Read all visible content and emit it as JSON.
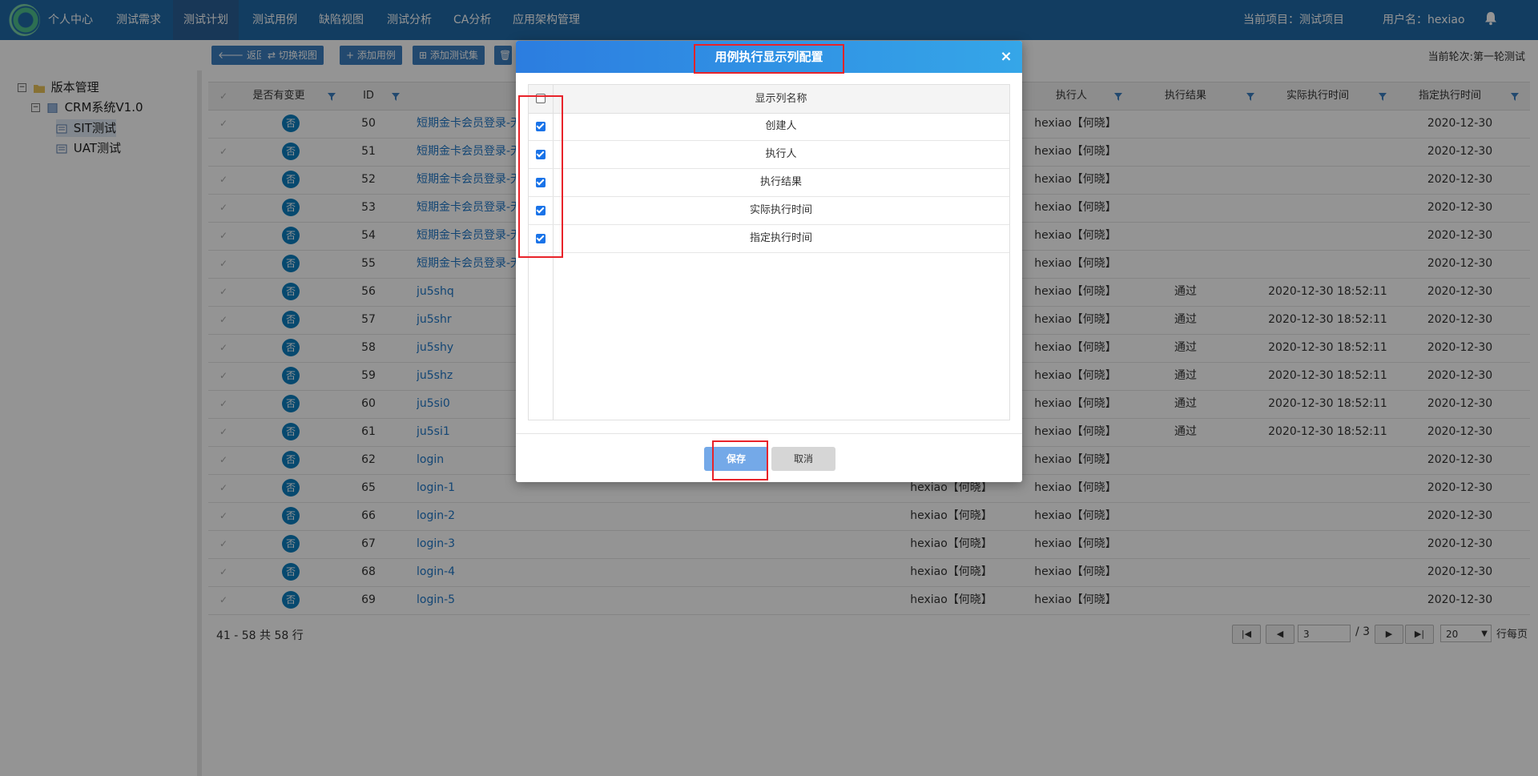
{
  "nav": {
    "items": [
      "个人中心",
      "测试需求",
      "测试计划",
      "测试用例",
      "缺陷视图",
      "测试分析",
      "CA分析",
      "应用架构管理"
    ],
    "active_index": 2,
    "current_project": "当前项目：测试项目",
    "username": "用户名：hexiao"
  },
  "toolbar": {
    "buttons": [
      "返回",
      "切换视图",
      "添加用例",
      "添加测试集"
    ],
    "current_round": "当前轮次:第一轮测试"
  },
  "tree": {
    "root": "版本管理",
    "project": "CRM系统V1.0",
    "nodes": [
      "SIT测试",
      "UAT测试"
    ],
    "selected": "SIT测试"
  },
  "grid": {
    "headers": {
      "changed": "是否有变更",
      "id": "ID",
      "executor": "执行人",
      "result": "执行结果",
      "actual_time": "实际执行时间",
      "assigned_time": "指定执行时间"
    },
    "rows": [
      {
        "badge": "否",
        "id": "50",
        "name": "短期金卡会员登录-无",
        "creator": "",
        "executor": "hexiao【何晓】",
        "result": "",
        "actual": "",
        "assigned": "2020-12-30"
      },
      {
        "badge": "否",
        "id": "51",
        "name": "短期金卡会员登录-无",
        "creator": "",
        "executor": "hexiao【何晓】",
        "result": "",
        "actual": "",
        "assigned": "2020-12-30"
      },
      {
        "badge": "否",
        "id": "52",
        "name": "短期金卡会员登录-无",
        "creator": "",
        "executor": "hexiao【何晓】",
        "result": "",
        "actual": "",
        "assigned": "2020-12-30"
      },
      {
        "badge": "否",
        "id": "53",
        "name": "短期金卡会员登录-无",
        "creator": "",
        "executor": "hexiao【何晓】",
        "result": "",
        "actual": "",
        "assigned": "2020-12-30"
      },
      {
        "badge": "否",
        "id": "54",
        "name": "短期金卡会员登录-无",
        "creator": "",
        "executor": "hexiao【何晓】",
        "result": "",
        "actual": "",
        "assigned": "2020-12-30"
      },
      {
        "badge": "否",
        "id": "55",
        "name": "短期金卡会员登录-无",
        "creator": "",
        "executor": "hexiao【何晓】",
        "result": "",
        "actual": "",
        "assigned": "2020-12-30"
      },
      {
        "badge": "否",
        "id": "56",
        "name": "ju5shq",
        "creator": "",
        "executor": "hexiao【何晓】",
        "result": "通过",
        "actual": "2020-12-30 18:52:11",
        "assigned": "2020-12-30"
      },
      {
        "badge": "否",
        "id": "57",
        "name": "ju5shr",
        "creator": "",
        "executor": "hexiao【何晓】",
        "result": "通过",
        "actual": "2020-12-30 18:52:11",
        "assigned": "2020-12-30"
      },
      {
        "badge": "否",
        "id": "58",
        "name": "ju5shy",
        "creator": "",
        "executor": "hexiao【何晓】",
        "result": "通过",
        "actual": "2020-12-30 18:52:11",
        "assigned": "2020-12-30"
      },
      {
        "badge": "否",
        "id": "59",
        "name": "ju5shz",
        "creator": "",
        "executor": "hexiao【何晓】",
        "result": "通过",
        "actual": "2020-12-30 18:52:11",
        "assigned": "2020-12-30"
      },
      {
        "badge": "否",
        "id": "60",
        "name": "ju5si0",
        "creator": "",
        "executor": "hexiao【何晓】",
        "result": "通过",
        "actual": "2020-12-30 18:52:11",
        "assigned": "2020-12-30"
      },
      {
        "badge": "否",
        "id": "61",
        "name": "ju5si1",
        "creator": "",
        "executor": "hexiao【何晓】",
        "result": "通过",
        "actual": "2020-12-30 18:52:11",
        "assigned": "2020-12-30"
      },
      {
        "badge": "否",
        "id": "62",
        "name": "login",
        "creator": "",
        "executor": "hexiao【何晓】",
        "result": "",
        "actual": "",
        "assigned": "2020-12-30"
      },
      {
        "badge": "否",
        "id": "65",
        "name": "login-1",
        "creator": "hexiao【何晓】",
        "executor": "hexiao【何晓】",
        "result": "",
        "actual": "",
        "assigned": "2020-12-30"
      },
      {
        "badge": "否",
        "id": "66",
        "name": "login-2",
        "creator": "hexiao【何晓】",
        "executor": "hexiao【何晓】",
        "result": "",
        "actual": "",
        "assigned": "2020-12-30"
      },
      {
        "badge": "否",
        "id": "67",
        "name": "login-3",
        "creator": "hexiao【何晓】",
        "executor": "hexiao【何晓】",
        "result": "",
        "actual": "",
        "assigned": "2020-12-30"
      },
      {
        "badge": "否",
        "id": "68",
        "name": "login-4",
        "creator": "hexiao【何晓】",
        "executor": "hexiao【何晓】",
        "result": "",
        "actual": "",
        "assigned": "2020-12-30"
      },
      {
        "badge": "否",
        "id": "69",
        "name": "login-5",
        "creator": "hexiao【何晓】",
        "executor": "hexiao【何晓】",
        "result": "",
        "actual": "",
        "assigned": "2020-12-30"
      }
    ]
  },
  "pager": {
    "summary": "41 - 58 共 58 行",
    "page_value": "3",
    "page_total": "/ 3",
    "page_size": "20",
    "per_page_label": "行每页"
  },
  "modal": {
    "title": "用例执行显示列配置",
    "close": "×",
    "column_header": "显示列名称",
    "columns": [
      {
        "label": "创建人",
        "checked": true
      },
      {
        "label": "执行人",
        "checked": true
      },
      {
        "label": "执行结果",
        "checked": true
      },
      {
        "label": "实际执行时间",
        "checked": true
      },
      {
        "label": "指定执行时间",
        "checked": true
      }
    ],
    "save": "保存",
    "cancel": "取消"
  }
}
